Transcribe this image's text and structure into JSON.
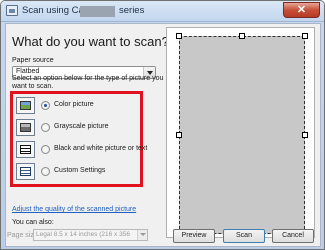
{
  "window": {
    "title_prefix": "Scan using Canon",
    "title_suffix": "series",
    "close_symbol": "✕"
  },
  "main": {
    "heading": "What do you want to scan?",
    "paper_source_label": "Paper source",
    "paper_source_value": "Flatbed",
    "instruction_line1": "Select an option below for the type of picture you",
    "instruction_line2": "want to scan.",
    "options": [
      {
        "label": "Color picture",
        "icon": "color-picture-icon",
        "selected": true
      },
      {
        "label": "Grayscale picture",
        "icon": "grayscale-picture-icon",
        "selected": false
      },
      {
        "label": "Black and white picture or text",
        "icon": "black-white-picture-icon",
        "selected": false
      },
      {
        "label": "Custom Settings",
        "icon": "custom-settings-icon",
        "selected": false
      }
    ],
    "you_can_also": "You can also:",
    "adjust_link": "Adjust the quality of the scanned picture",
    "page_size_label": "Page size:",
    "page_size_value": "Legal 8.5 x 14 inches (216 x 356"
  },
  "buttons": {
    "preview": "Preview",
    "scan": "Scan",
    "cancel": "Cancel"
  },
  "colors": {
    "highlight_box": "#e0121f",
    "link": "#1f5fbf"
  }
}
